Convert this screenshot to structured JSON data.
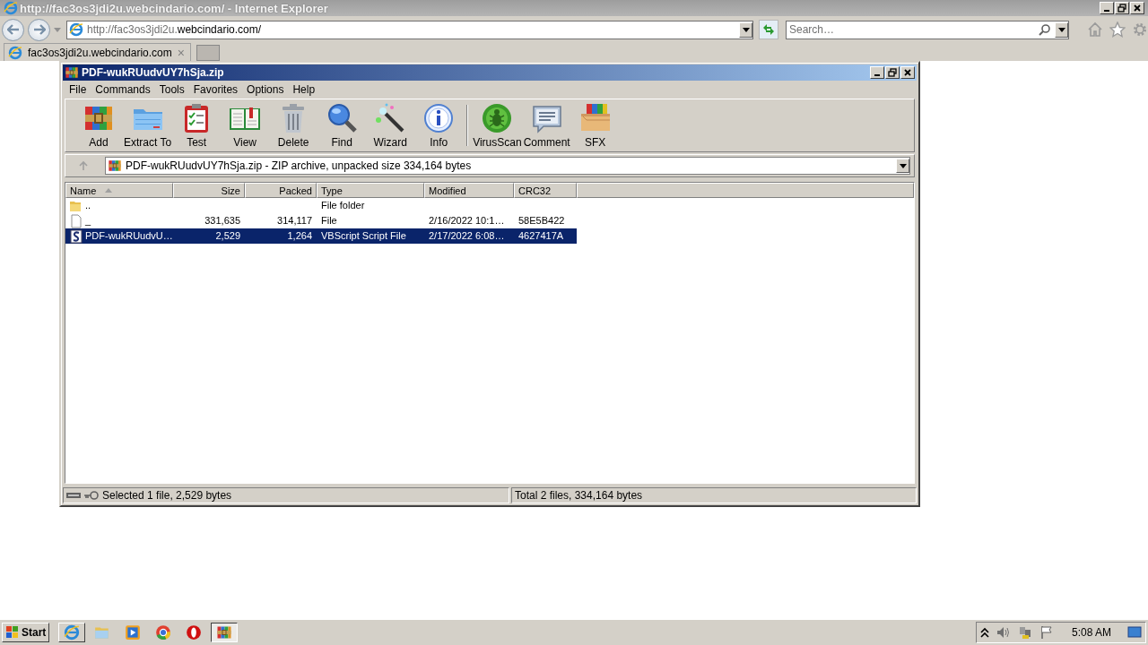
{
  "browser": {
    "title": "http://fac3os3jdi2u.webcindario.com/ - Internet Explorer",
    "address": {
      "prefix": "http://fac3os3jdi2u.",
      "domain": "webcindario.com/"
    },
    "search": {
      "placeholder": "Search…"
    },
    "tabs": [
      {
        "label": "fac3os3jdi2u.webcindario.com",
        "close": "×",
        "selected": true
      }
    ]
  },
  "archive_window": {
    "title": "PDF-wukRUudvUY7hSja.zip",
    "menu": [
      "File",
      "Commands",
      "Tools",
      "Favorites",
      "Options",
      "Help"
    ],
    "toolbar_groups": [
      {
        "buttons": [
          "Add",
          "Extract To",
          "Test",
          "View",
          "Delete",
          "Find",
          "Wizard",
          "Info"
        ]
      },
      {
        "buttons": [
          "VirusScan",
          "Comment",
          "SFX"
        ]
      }
    ],
    "path": "PDF-wukRUudvUY7hSja.zip - ZIP archive, unpacked size 334,164 bytes",
    "columns": [
      {
        "label": "Name",
        "sorted": true
      },
      {
        "label": "Size",
        "sorted": false
      },
      {
        "label": "Packed",
        "sorted": false
      },
      {
        "label": "Type",
        "sorted": false
      },
      {
        "label": "Modified",
        "sorted": false
      },
      {
        "label": "CRC32",
        "sorted": false
      }
    ],
    "rows": [
      {
        "kind": "folder",
        "name": "..",
        "type": "File folder",
        "selected": false
      },
      {
        "kind": "file",
        "name": "_",
        "size": "331,635",
        "packed": "314,117",
        "type": "File",
        "modified": "2/16/2022 10:1…",
        "crc32": "58E5B422",
        "selected": false
      },
      {
        "kind": "script",
        "name": "PDF-wukRUudvU…",
        "size": "2,529",
        "packed": "1,264",
        "type": "VBScript Script File",
        "modified": "2/17/2022 6:08…",
        "crc32": "4627417A",
        "selected": true
      }
    ],
    "status": {
      "left": "Selected 1 file, 2,529 bytes",
      "right": "Total 2 files, 334,164 bytes"
    }
  },
  "taskbar": {
    "start": "Start",
    "apps": [
      {
        "selected": false
      },
      {
        "selected": false
      },
      {
        "selected": false
      },
      {
        "selected": false
      },
      {
        "selected": false
      },
      {
        "selected": true
      }
    ],
    "clock": "5:08 AM"
  }
}
